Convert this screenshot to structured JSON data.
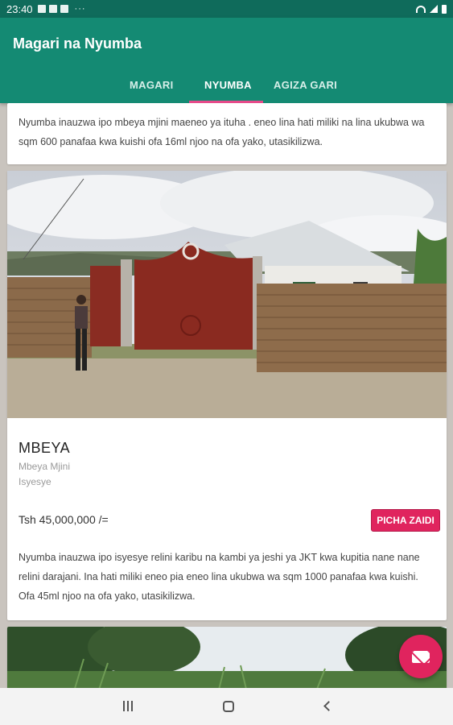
{
  "status_bar": {
    "time": "23:40",
    "dots": "···"
  },
  "app_bar": {
    "title": "Magari na Nyumba",
    "tabs": [
      {
        "label": "MAGARI",
        "active": false
      },
      {
        "label": "NYUMBA",
        "active": true
      },
      {
        "label": "AGIZA GARI",
        "active": false
      }
    ]
  },
  "listings": [
    {
      "description": "Nyumba inauzwa ipo mbeya mjini maeneo ya ituha . eneo lina hati miliki na lina ukubwa wa sqm 600 panafaa kwa kuishi ofa 16ml njoo na ofa yako, utasikilizwa."
    },
    {
      "city": "MBEYA",
      "area": "Mbeya Mjini",
      "location": "Isyesye",
      "price": "Tsh 45,000,000 /=",
      "button_label": "PICHA ZAIDI",
      "description": "Nyumba inauzwa ipo isyesye relini karibu na kambi ya jeshi ya JKT kwa kupitia nane nane relini darajani.  Ina hati miliki eneo pia eneo lina ukubwa wa sqm 1000 panafaa kwa kuishi. Ofa 45ml njoo na ofa yako, utasikilizwa."
    }
  ],
  "fab": {
    "icon": "mail-icon"
  },
  "colors": {
    "primary": "#148a73",
    "status_bar": "#0f6b5b",
    "accent": "#e0245e",
    "tab_indicator": "#e64a8a"
  }
}
